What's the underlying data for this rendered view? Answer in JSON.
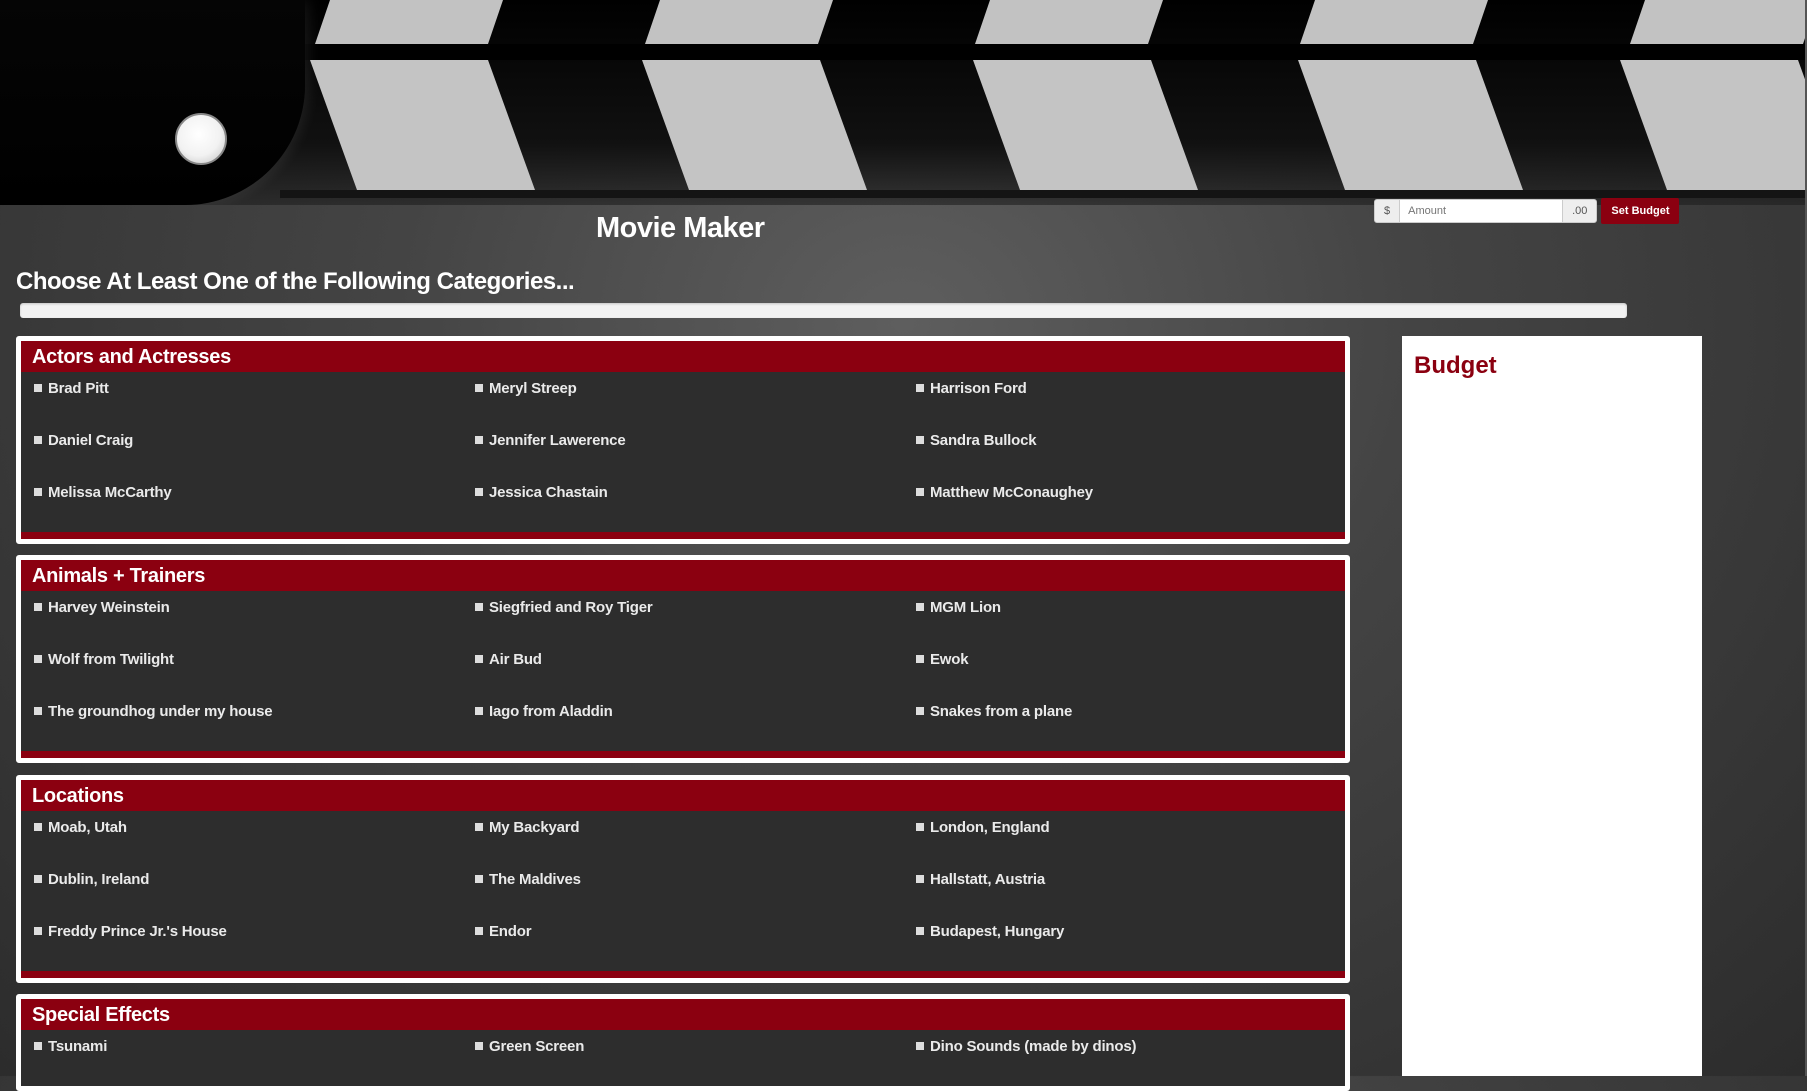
{
  "header": {
    "title": "Movie Maker",
    "instructions": "Choose At Least One of the Following Categories..."
  },
  "budget_form": {
    "currency_symbol": "$",
    "amount_placeholder": "Amount",
    "amount_value": "",
    "cents_suffix": ".00",
    "set_button_label": "Set Budget"
  },
  "progress": {
    "fraction": 0.0
  },
  "categories": [
    {
      "title": "Actors and Actresses",
      "items": [
        "Brad Pitt",
        "Meryl Streep",
        "Harrison Ford",
        "Daniel Craig",
        "Jennifer Lawerence",
        "Sandra Bullock",
        "Melissa McCarthy",
        "Jessica Chastain",
        "Matthew McConaughey"
      ]
    },
    {
      "title": "Animals + Trainers",
      "items": [
        "Harvey Weinstein",
        "Siegfried and Roy Tiger",
        "MGM Lion",
        "Wolf from Twilight",
        "Air Bud",
        "Ewok",
        "The groundhog under my house",
        "Iago from Aladdin",
        "Snakes from a plane"
      ]
    },
    {
      "title": "Locations",
      "items": [
        "Moab, Utah",
        "My Backyard",
        "London, England",
        "Dublin, Ireland",
        "The Maldives",
        "Hallstatt, Austria",
        "Freddy Prince Jr.'s House",
        "Endor",
        "Budapest, Hungary"
      ]
    },
    {
      "title": "Special Effects",
      "items": [
        "Tsunami",
        "Green Screen",
        "Dino Sounds (made by dinos)"
      ]
    }
  ],
  "budget_panel": {
    "heading": "Budget"
  },
  "colors": {
    "accent": "#8b0010",
    "panel_bg": "#2d2d2d",
    "page_bg": "#4a4a4a"
  },
  "icons": {
    "item_bullet": "square-bullet-icon",
    "clapper_knob": "clapper-hinge-icon"
  }
}
